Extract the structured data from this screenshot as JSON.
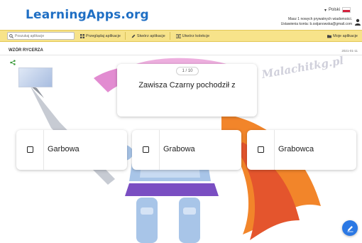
{
  "header": {
    "logo": "LearningApps.org",
    "language": "Polski",
    "messages": "Masz 1 nowych prywatnych wiadomości.",
    "account": "Ustawienia konta: b.ostjanowska@gmail.com"
  },
  "toolbar": {
    "search_placeholder": "Poszukaj aplikacje",
    "browse": "Przeglądaj aplikacje",
    "create": "Stwórz aplikacje",
    "collection": "Utwórz kolekcje",
    "my_apps": "Moje aplikacje"
  },
  "page": {
    "title": "WZÓR RYCERZA",
    "date": "2021-01-11"
  },
  "watermark": "Malachitkg.pl",
  "quiz": {
    "counter": "1 / 10",
    "question": "Zawisza Czarny pochodził z",
    "answers": [
      "Garbowa",
      "Grabowa",
      "Grabowca"
    ]
  },
  "colors": {
    "logo": "#1f6fc4",
    "toolbar_bg": "#f7e38a",
    "fab": "#2b78e4"
  },
  "icons": {
    "share": "share-icon",
    "fab": "edit-icon"
  }
}
